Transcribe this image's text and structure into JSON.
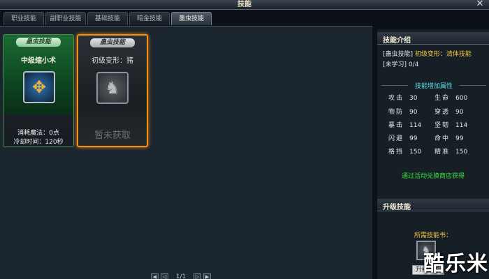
{
  "window": {
    "title": "技能"
  },
  "tabs": [
    {
      "label": "职业技能",
      "active": false
    },
    {
      "label": "副职业技能",
      "active": false
    },
    {
      "label": "基础技能",
      "active": false
    },
    {
      "label": "暗金技能",
      "active": false
    },
    {
      "label": "蛊虫技能",
      "active": true
    }
  ],
  "cards": [
    {
      "badge": "蛊虫技能",
      "name": "中级缩小术",
      "stat_mana": "消耗魔法：0点",
      "stat_cooldown": "冷却时间：120秒",
      "state": "active"
    },
    {
      "badge": "蛊虫技能",
      "name": "初级变形：猪",
      "locked_text": "暂未获取",
      "state": "locked"
    }
  ],
  "pager": {
    "page": "1/1"
  },
  "side": {
    "intro_title": "技能介绍",
    "intro_line1_tag": "[蛊虫技能]",
    "intro_line1_desc": "初级变形：清体技能",
    "intro_line2": "[未学习] 0/4",
    "attr_header": "技能增加属性",
    "attributes": [
      {
        "name": "攻击",
        "value": "30"
      },
      {
        "name": "生命",
        "value": "600"
      },
      {
        "name": "物防",
        "value": "90"
      },
      {
        "name": "穿透",
        "value": "90"
      },
      {
        "name": "暴击",
        "value": "114"
      },
      {
        "name": "坚韧",
        "value": "114"
      },
      {
        "name": "闪避",
        "value": "99"
      },
      {
        "name": "命中",
        "value": "99"
      },
      {
        "name": "格挡",
        "value": "150"
      },
      {
        "name": "精准",
        "value": "150"
      }
    ],
    "acquire_hint": "通过活动兑换商店获得",
    "upgrade_title": "升级技能",
    "need_label": "所需技能书：",
    "book_tip": "升级技能"
  },
  "watermark": "酷乐米",
  "colors": {
    "accent": "#f0921a",
    "highlight_green": "#3be040",
    "gold": "#f5c542",
    "cyan": "#5fe2f0"
  }
}
